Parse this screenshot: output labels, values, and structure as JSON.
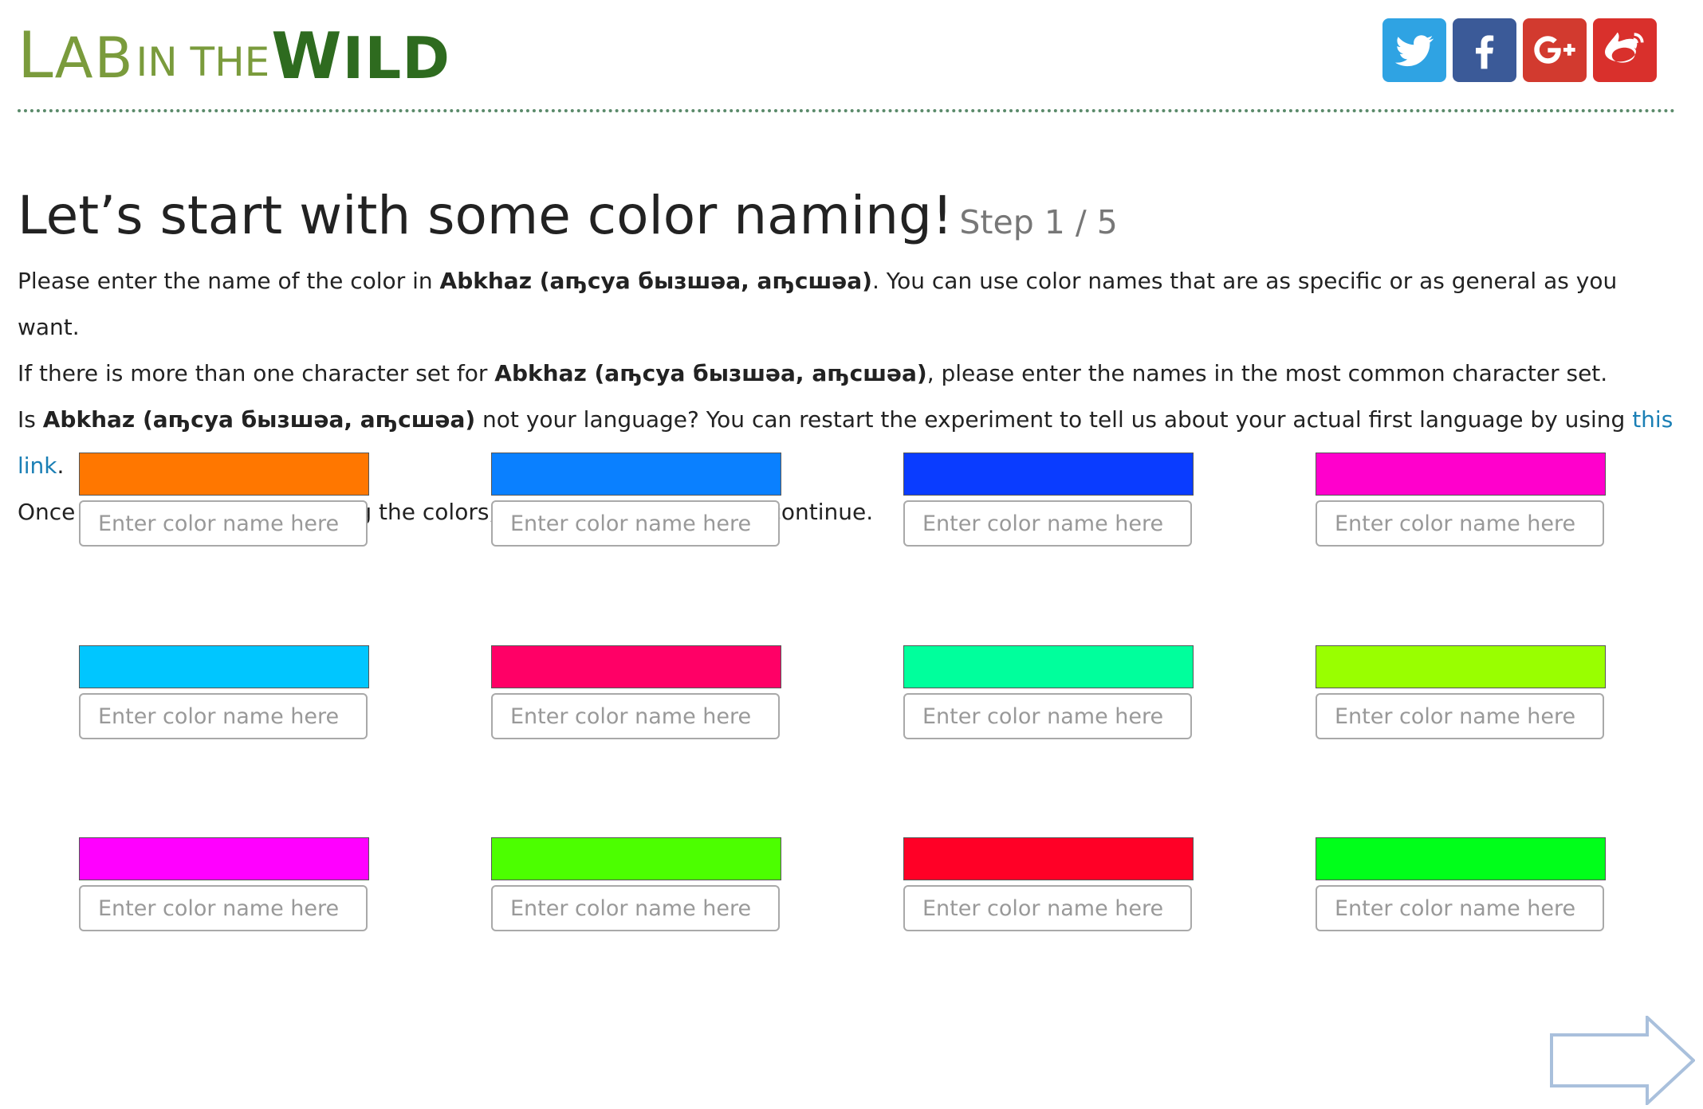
{
  "header": {
    "logo": {
      "l": "L",
      "ab": "AB",
      "in_the": "IN THE",
      "w": "W",
      "ild": "ILD"
    },
    "social": [
      {
        "name": "twitter",
        "icon": "twitter-icon",
        "color": "#2fa3e3"
      },
      {
        "name": "facebook",
        "icon": "facebook-icon",
        "color": "#3b5a98"
      },
      {
        "name": "googleplus",
        "icon": "google-plus-icon",
        "color": "#d23a2f"
      },
      {
        "name": "weibo",
        "icon": "weibo-icon",
        "color": "#d9302c"
      }
    ]
  },
  "main": {
    "title": "Let’s start with some color naming!",
    "step": "Step 1 / 5",
    "language": "Abkhaz (аҧсуа бызшәа, аҧсшәа)",
    "p1_before": "Please enter the name of the color in ",
    "p1_after": ". You can use color names that are as specific or as general as you want.",
    "p2_before": "If there is more than one character set for ",
    "p2_after": ", please enter the names in the most common character set.",
    "p3_before": "Is ",
    "p3_mid": " not your language? You can restart the experiment to tell us about your actual first language by using ",
    "p3_link": "this link",
    "p3_after": ".",
    "p4": "Once you have finished naming the colors, press the blue arrow to continue."
  },
  "colors": {
    "placeholder": "Enter color name here",
    "swatches": [
      "#ff7700",
      "#0a80ff",
      "#0a3cff",
      "#ff00cc",
      "#00c6ff",
      "#ff0066",
      "#00ff9c",
      "#99ff00",
      "#ff00ff",
      "#4cff00",
      "#ff0026",
      "#00ff1a"
    ]
  },
  "next": {
    "icon": "right-arrow-icon",
    "color": "#a9c0dc"
  }
}
